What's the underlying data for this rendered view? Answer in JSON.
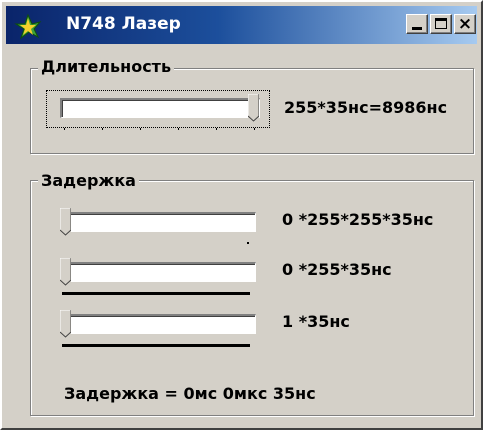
{
  "window": {
    "title": "N748 Лазер",
    "controls": {
      "minimize": "_",
      "maximize": "□",
      "close": "×"
    }
  },
  "duration_group": {
    "label": "Длительность",
    "slider": {
      "value": 255,
      "max": 255
    },
    "readout": "255*35нс=8986нс"
  },
  "delay_group": {
    "label": "Задержка",
    "sliders": [
      {
        "value": 0,
        "max": 255,
        "readout": "0 *255*255*35нс"
      },
      {
        "value": 0,
        "max": 255,
        "readout": "0 *255*35нс"
      },
      {
        "value": 1,
        "max": 255,
        "readout": "1 *35нс"
      }
    ],
    "summary": "Задержка = 0мс 0мкс 35нс"
  },
  "colors": {
    "face": "#d4d0c8",
    "title_start": "#0a246a",
    "title_end": "#a6caf0"
  }
}
